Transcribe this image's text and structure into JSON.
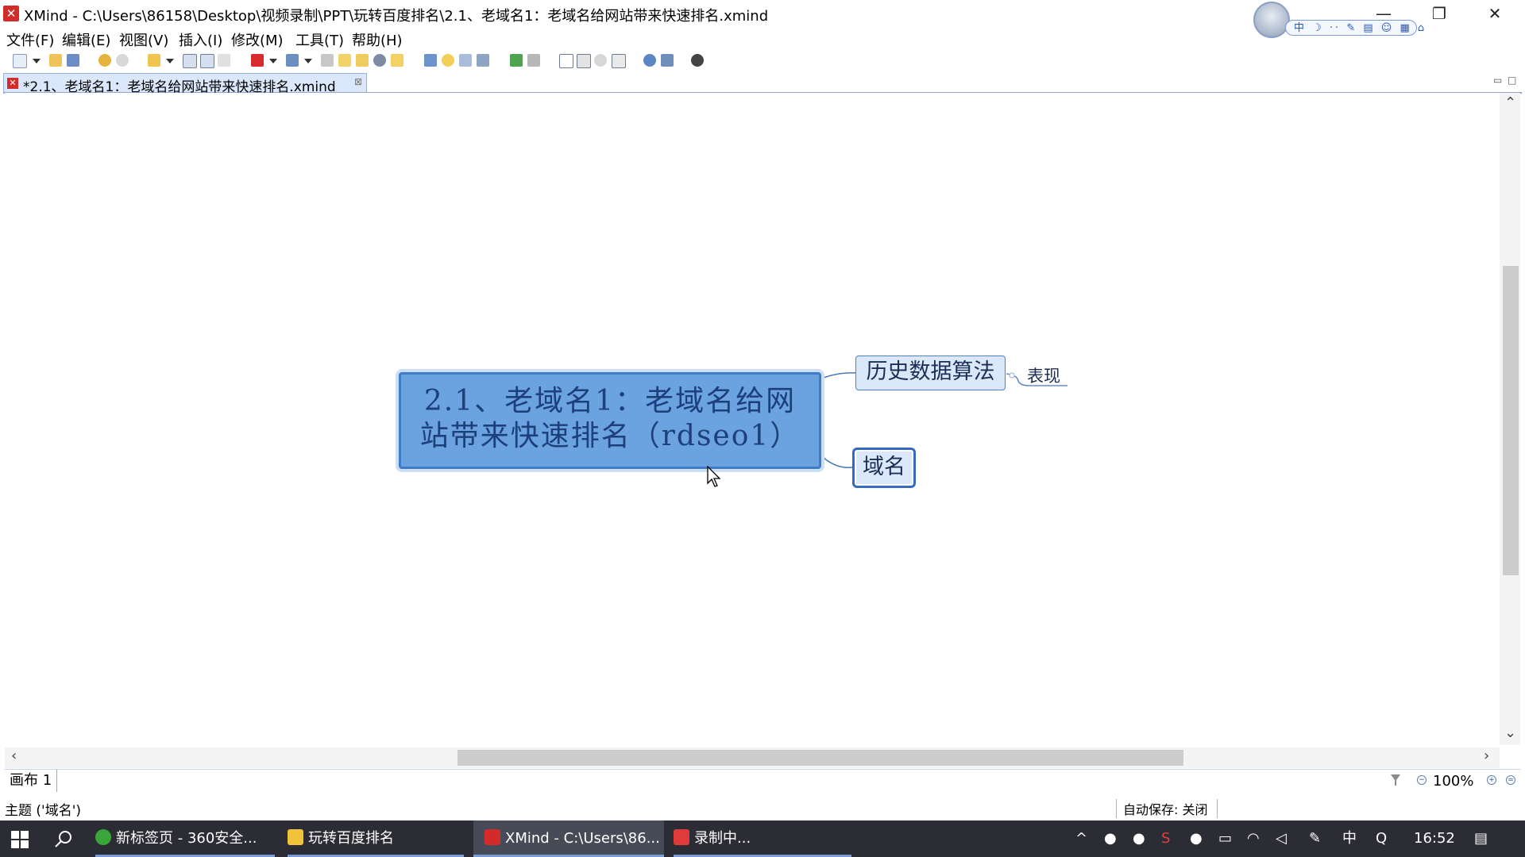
{
  "window": {
    "title": "XMind - C:\\Users\\86158\\Desktop\\视频录制\\PPT\\玩转百度排名\\2.1、老域名1：老域名给网站带来快速排名.xmind",
    "app_icon_glyph": "✕",
    "minimize": "—",
    "restore": "❐",
    "close": "✕"
  },
  "qq_widget": {
    "toolbar_text": "中 ☽ ·· ✎ ▤ ☺ ▦ ⌂"
  },
  "menu": [
    "文件(F)",
    "编辑(E)",
    "视图(V)",
    "插入(I)",
    "修改(M)",
    "工具(T)",
    "帮助(H)"
  ],
  "toolbar_icons": [
    "new-icon",
    "open-icon",
    "save-icon",
    "undo-icon",
    "redo-icon",
    "topic-icon",
    "subtopic-icon",
    "boundary-icon",
    "summary-icon",
    "presentation-icon",
    "image-icon",
    "hyperlink-icon",
    "note-icon",
    "label-icon",
    "marker-icon",
    "comment-icon",
    "callout-icon",
    "relationship-icon",
    "filter-icon",
    "drilldown-icon",
    "drillup-icon",
    "outline-icon",
    "overview-icon",
    "brainstorm-icon",
    "zoom-icon",
    "share-icon",
    "export-icon",
    "settings-icon"
  ],
  "editor_tab": {
    "label": "*2.1、老域名1：老域名给网站带来快速排名.xmind",
    "close": "⊠"
  },
  "mindmap": {
    "central_topic_line1": "2.1、老域名1：老域名给网",
    "central_topic_line2": "站带来快速排名（rdseo1）",
    "branch_history": "历史数据算法",
    "subtopic_performance": "表现",
    "branch_domain": "域名"
  },
  "sheet": {
    "tab_label": "画布 1",
    "zoom_level": "100%"
  },
  "status": {
    "selection": "主题 ('域名')",
    "autosave": "自动保存: 关闭"
  },
  "taskbar": {
    "tasks": [
      {
        "label": "新标签页 - 360安全...",
        "color": "#3aa53a"
      },
      {
        "label": "玩转百度排名",
        "color": "#f2c23a"
      },
      {
        "label": "XMind - C:\\Users\\86...",
        "color": "#d32a2a"
      },
      {
        "label": "录制中...",
        "color": "#e03b3b"
      }
    ],
    "tray": {
      "ime": "中",
      "clock": "16:52"
    }
  },
  "colors": {
    "central_fill": "#6aa3e0",
    "central_border": "#3f7bc7",
    "branch_fill": "#dbe8fa",
    "selected_border": "#3569c2",
    "taskbar_bg": "#2c2c34"
  }
}
